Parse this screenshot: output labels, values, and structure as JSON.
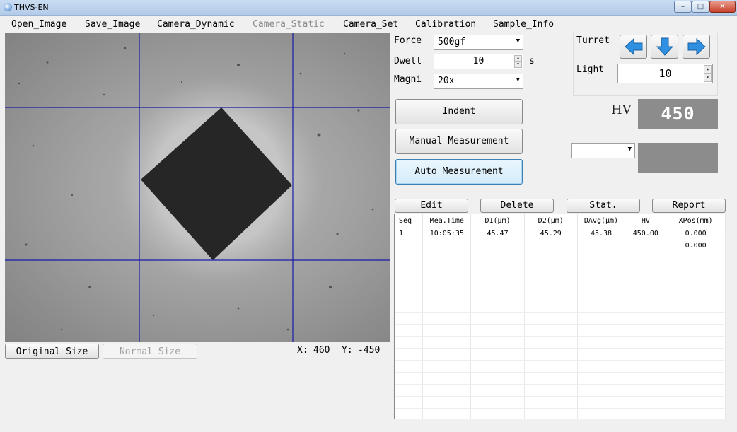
{
  "window": {
    "title": "THVS-EN",
    "minimize": "–",
    "maximize": "□",
    "close": "✕"
  },
  "menu": [
    "Open_Image",
    "Save_Image",
    "Camera_Dynamic",
    "Camera_Static",
    "Camera_Set",
    "Calibration",
    "Sample_Info"
  ],
  "menu_disabled": [
    "Camera_Static"
  ],
  "view_buttons": {
    "original": "Original Size",
    "normal": "Normal Size"
  },
  "cursor": {
    "x_label": "X:",
    "x_value": "460",
    "y_label": "Y:",
    "y_value": "-450"
  },
  "settings": {
    "force_label": "Force",
    "force_value": "500gf",
    "dwell_label": "Dwell",
    "dwell_value": "10",
    "dwell_unit": "s",
    "magni_label": "Magni",
    "magni_value": "20x"
  },
  "actions": {
    "indent": "Indent",
    "manual": "Manual Measurement",
    "auto": "Auto Measurement"
  },
  "turret": {
    "label": "Turret",
    "light_label": "Light",
    "light_value": "10",
    "icons": [
      "arrow-left-icon",
      "arrow-down-icon",
      "arrow-right-icon"
    ]
  },
  "hv": {
    "label": "HV",
    "value": "450"
  },
  "table_buttons": {
    "edit": "Edit",
    "delete": "Delete",
    "stat": "Stat.",
    "report": "Report"
  },
  "table": {
    "columns": [
      "Seq",
      "Mea.Time",
      "D1(µm)",
      "D2(µm)",
      "DAvg(µm)",
      "HV",
      "XPos(mm)"
    ],
    "rows": [
      [
        "1",
        "10:05:35",
        "45.47",
        "45.29",
        "45.38",
        "450.00",
        "0.000"
      ],
      [
        "",
        "",
        "",
        "",
        "",
        "",
        "0.000"
      ]
    ]
  },
  "colors": {
    "crosshair": "#1a1aa8",
    "indent": "#262626",
    "arrow": "#2f8fe0",
    "display": "#8c8c8c"
  }
}
